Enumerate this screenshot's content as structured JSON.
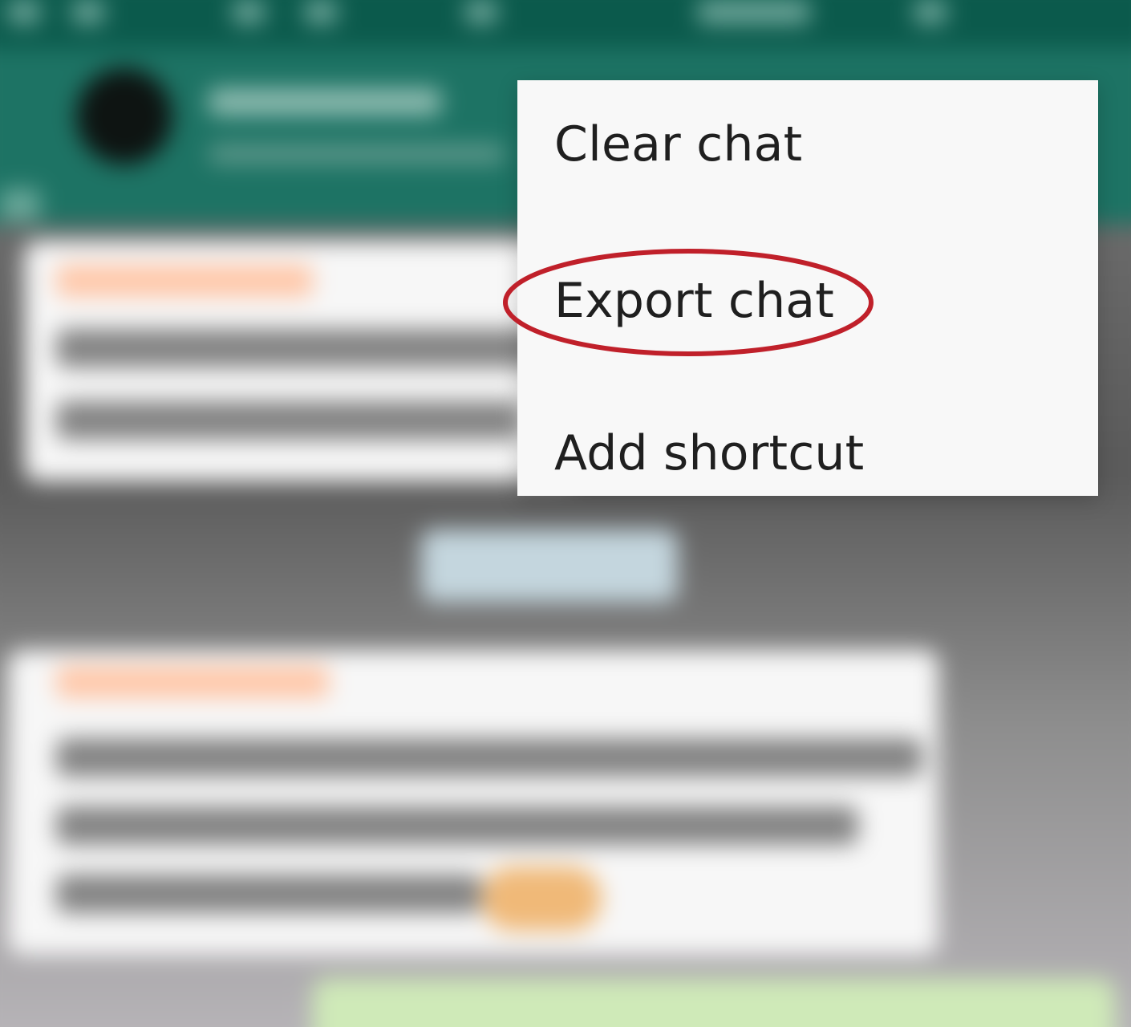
{
  "menu": {
    "items": [
      {
        "label": "Clear chat"
      },
      {
        "label": "Export chat"
      },
      {
        "label": "Add shortcut"
      }
    ],
    "highlighted_item": "Export chat"
  },
  "colors": {
    "header_green": "#1d7364",
    "statusbar_green": "#0b5a4c",
    "menu_background": "#f8f8f8",
    "menu_text": "#1f1f1f",
    "highlight_ring": "#c0202a"
  }
}
